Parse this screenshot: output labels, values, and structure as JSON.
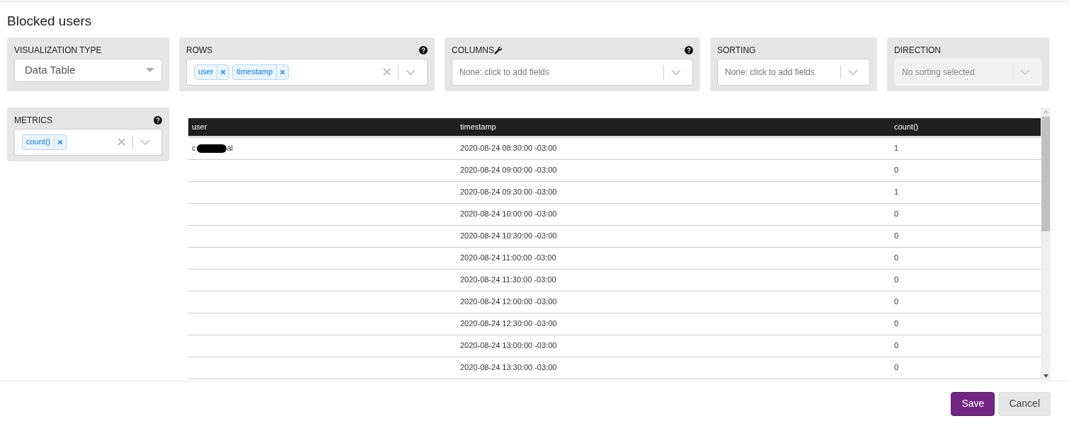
{
  "title": "Blocked users",
  "controls": [
    {
      "label": "VISUALIZATION TYPE",
      "help": false,
      "kind": "dropdown",
      "value": "Data Table",
      "disabled": false
    },
    {
      "label": "ROWS",
      "help": true,
      "kind": "multi",
      "tags": [
        "user",
        "timestamp"
      ],
      "disabled": false
    },
    {
      "label": "COLUMNS",
      "help": true,
      "wrench": true,
      "kind": "multi",
      "placeholder": "None: click to add fields",
      "disabled": false
    },
    {
      "label": "SORTING",
      "help": false,
      "kind": "multi",
      "placeholder": "None: click to add fields",
      "disabled": false
    },
    {
      "label": "DIRECTION",
      "help": false,
      "kind": "multi",
      "placeholder": "No sorting selected",
      "disabled": true
    }
  ],
  "metrics": {
    "label": "METRICS",
    "help": true,
    "kind": "multi",
    "tags": [
      "count()"
    ],
    "disabled": false
  },
  "table": {
    "columns": [
      "user",
      "timestamp",
      "count()"
    ],
    "rows": [
      {
        "user": {
          "start": "c",
          "end": "al",
          "redacted": true
        },
        "timestamp": "2020-08-24 08:30:00 -03:00",
        "count": "1"
      },
      {
        "timestamp": "2020-08-24 09:00:00 -03:00",
        "count": "0"
      },
      {
        "timestamp": "2020-08-24 09:30:00 -03:00",
        "count": "1"
      },
      {
        "timestamp": "2020-08-24 10:00:00 -03:00",
        "count": "0"
      },
      {
        "timestamp": "2020-08-24 10:30:00 -03:00",
        "count": "0"
      },
      {
        "timestamp": "2020-08-24 11:00:00 -03:00",
        "count": "0"
      },
      {
        "timestamp": "2020-08-24 11:30:00 -03:00",
        "count": "0"
      },
      {
        "timestamp": "2020-08-24 12:00:00 -03:00",
        "count": "0"
      },
      {
        "timestamp": "2020-08-24 12:30:00 -03:00",
        "count": "0"
      },
      {
        "timestamp": "2020-08-24 13:00:00 -03:00",
        "count": "0"
      },
      {
        "timestamp": "2020-08-24 13:30:00 -03:00",
        "count": "0"
      }
    ]
  },
  "buttons": [
    {
      "label": "Save",
      "kind": "primary"
    },
    {
      "label": "Cancel",
      "kind": "secondary"
    }
  ]
}
